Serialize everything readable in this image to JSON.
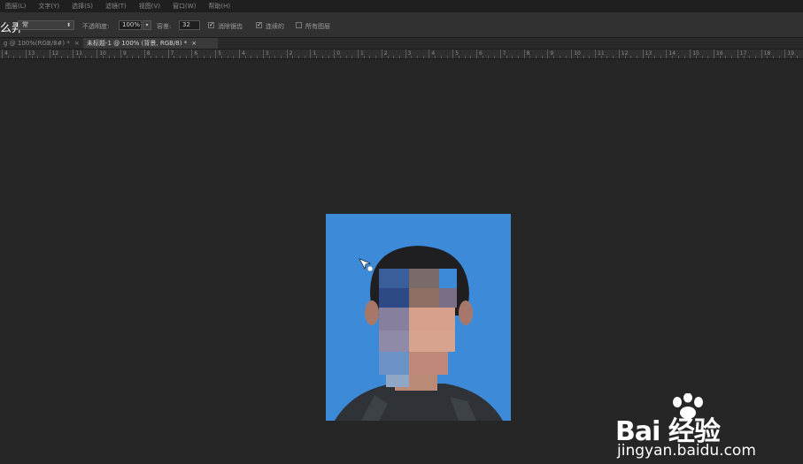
{
  "menubar": {
    "items": [
      "图层(L)",
      "文字(Y)",
      "选择(S)",
      "滤镜(T)",
      "视图(V)",
      "窗口(W)",
      "帮助(H)"
    ]
  },
  "title_overlay": "么弄",
  "options": {
    "mode_value": "常",
    "opacity_label": "不透明度:",
    "opacity_value": "100%",
    "tolerance_label": "容差:",
    "tolerance_value": "32",
    "anti_alias_label": "消除锯齿",
    "contiguous_label": "连续的",
    "all_layers_label": "所有图层"
  },
  "tabs": [
    {
      "label": "g @ 100%(RGB/8#) *",
      "active": false
    },
    {
      "label": "未标题-1 @ 100% (背景, RGB/8) *",
      "active": true
    }
  ],
  "ruler": {
    "labels": [
      "4",
      "13",
      "12",
      "11",
      "10",
      "9",
      "8",
      "7",
      "6",
      "5",
      "4",
      "3",
      "2",
      "1",
      "0",
      "1",
      "2",
      "3",
      "4",
      "5",
      "6",
      "7",
      "8",
      "9",
      "10",
      "11",
      "12",
      "13",
      "14",
      "15",
      "16",
      "17",
      "18",
      "19"
    ]
  },
  "colors": {
    "photo_background": "#3c8ad8",
    "app_background": "#262626"
  },
  "watermark": {
    "brand": "Bai 经验",
    "url": "jingyan.baidu.com"
  }
}
